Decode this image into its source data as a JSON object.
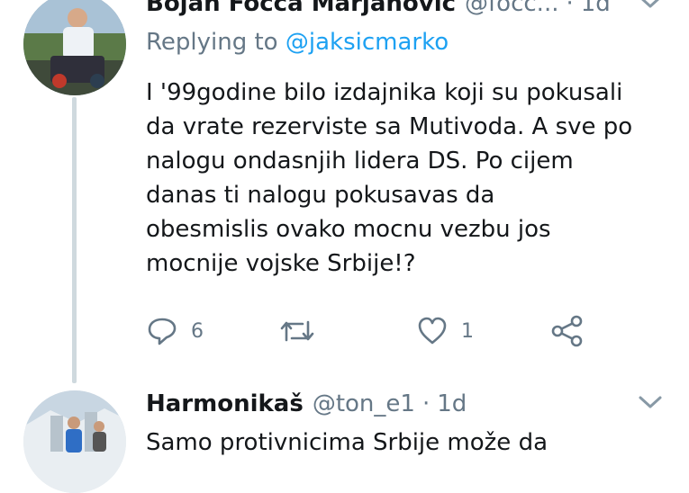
{
  "tweets": [
    {
      "display_name": "Bojan Focca Marjanović",
      "handle": "@focc...",
      "time": "1d",
      "replying_label": "Replying to",
      "replying_to": "@jaksicmarko",
      "text_lines": [
        "I '99godine bilo izdajnika koji su pokusali",
        "da vrate rezerviste sa Mutivoda. A sve po",
        "nalogu ondasnjih lidera DS. Po cijem",
        "danas ti nalogu pokusavas da",
        "obesmislis ovako mocnu vezbu jos",
        "mocnije vojske Srbije!?"
      ],
      "reply_count": "6",
      "retweet_count": "",
      "like_count": "1"
    },
    {
      "display_name": "Harmonikaš",
      "handle": "@ton_e1",
      "time": "1d",
      "text_lines": [
        "Samo protivnicima Srbije može da"
      ]
    }
  ],
  "colors": {
    "text": "#14171a",
    "secondary": "#657786",
    "link": "#1da1f2",
    "thread_line": "#cfd9de"
  }
}
